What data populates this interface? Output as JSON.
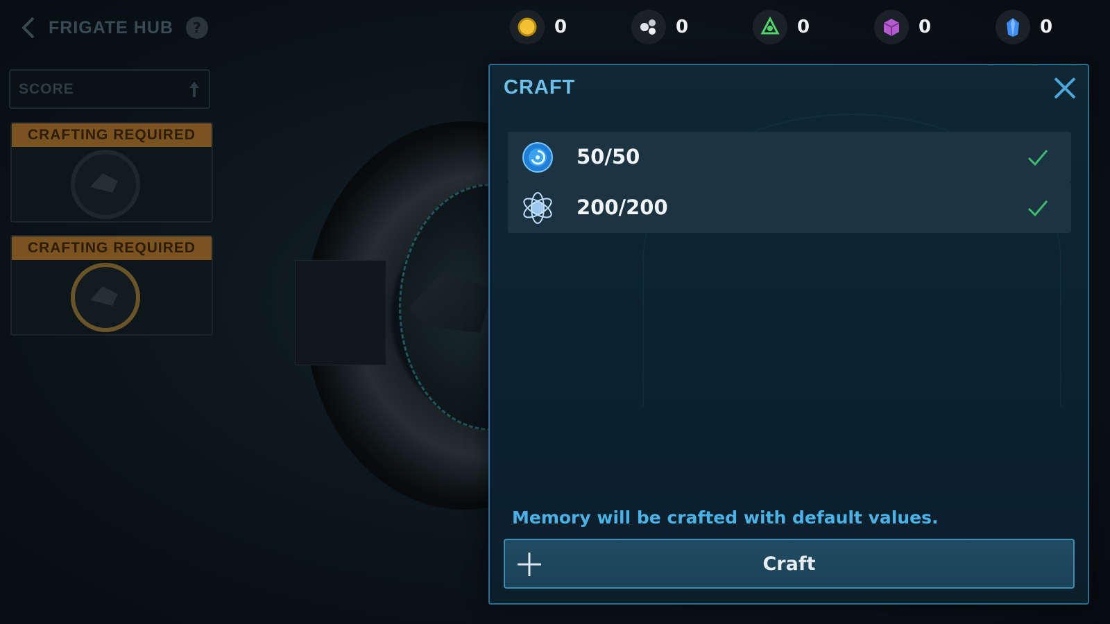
{
  "header": {
    "title": "FRIGATE HUB",
    "help_glyph": "?"
  },
  "currencies": [
    {
      "icon": "gold-coin-icon",
      "value": "0",
      "color": "#f2c230"
    },
    {
      "icon": "material-cluster-icon",
      "value": "0",
      "color": "#dfe5e8"
    },
    {
      "icon": "green-reactor-icon",
      "value": "0",
      "color": "#4fd36a"
    },
    {
      "icon": "purple-cube-icon",
      "value": "0",
      "color": "#b35ccd"
    },
    {
      "icon": "blue-crystal-icon",
      "value": "0",
      "color": "#3f8df0"
    }
  ],
  "sidebar": {
    "score_label": "SCORE",
    "cards": [
      {
        "banner": "CRAFTING REQUIRED"
      },
      {
        "banner": "CRAFTING REQUIRED"
      }
    ]
  },
  "dialog": {
    "title": "CRAFT",
    "requirements": [
      {
        "icon": "blue-orb-icon",
        "amount": "50/50",
        "met": true
      },
      {
        "icon": "atom-icon",
        "amount": "200/200",
        "met": true
      }
    ],
    "info": "Memory will be crafted with default values.",
    "craft_button": "Craft"
  },
  "colors": {
    "accent": "#6ec0ea",
    "check": "#3fb872",
    "banner": "#7a5320"
  }
}
